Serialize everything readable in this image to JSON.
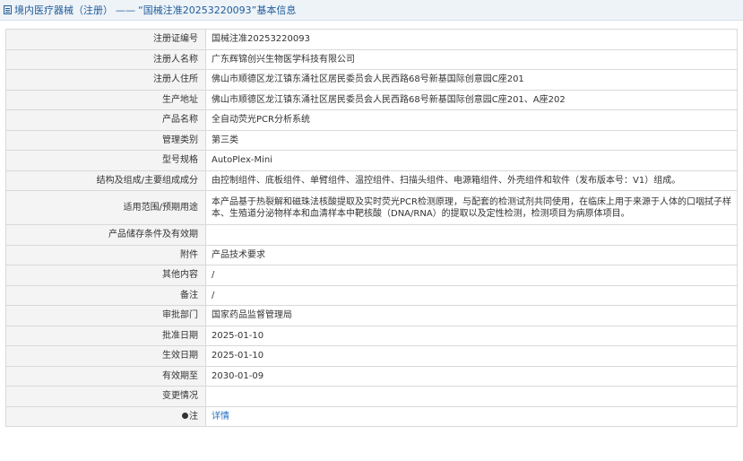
{
  "header": {
    "icon": "document-icon",
    "category": "境内医疗器械（注册）",
    "separator": "——",
    "title": "“国械注准20253220093”基本信息"
  },
  "rows": [
    {
      "label": "注册证编号",
      "value": "国械注准20253220093"
    },
    {
      "label": "注册人名称",
      "value": "广东辉锦创兴生物医学科技有限公司"
    },
    {
      "label": "注册人住所",
      "value": "佛山市顺德区龙江镇东涌社区居民委员会人民西路68号新基国际创意园C座201"
    },
    {
      "label": "生产地址",
      "value": "佛山市顺德区龙江镇东涌社区居民委员会人民西路68号新基国际创意园C座201、A座202"
    },
    {
      "label": "产品名称",
      "value": "全自动荧光PCR分析系统"
    },
    {
      "label": "管理类别",
      "value": "第三类"
    },
    {
      "label": "型号规格",
      "value": "AutoPlex-Mini"
    },
    {
      "label": "结构及组成/主要组成成分",
      "value": "由控制组件、底板组件、单臂组件、温控组件、扫描头组件、电源箱组件、外壳组件和软件（发布版本号：V1）组成。"
    },
    {
      "label": "适用范围/预期用途",
      "value": "本产品基于热裂解和磁珠法核酸提取及实时荧光PCR检测原理，与配套的检测试剂共同使用，在临床上用于来源于人体的口咽拭子样本、生殖道分泌物样本和血清样本中靶核酸（DNA/RNA）的提取以及定性检测，检测项目为病原体项目。"
    },
    {
      "label": "产品储存条件及有效期",
      "value": ""
    },
    {
      "label": "附件",
      "value": "产品技术要求"
    },
    {
      "label": "其他内容",
      "value": "/"
    },
    {
      "label": "备注",
      "value": "/"
    },
    {
      "label": "审批部门",
      "value": "国家药品监督管理局"
    },
    {
      "label": "批准日期",
      "value": "2025-01-10"
    },
    {
      "label": "生效日期",
      "value": "2025-01-10"
    },
    {
      "label": "有效期至",
      "value": "2030-01-09"
    },
    {
      "label": "变更情况",
      "value": ""
    },
    {
      "label": "注",
      "value": "详情"
    }
  ],
  "colors": {
    "header_bg": "#eef3f8",
    "header_text": "#1f5c99",
    "label_bg": "#f4f4f4",
    "border": "#d9d9d9",
    "link": "#1f6fbf"
  }
}
